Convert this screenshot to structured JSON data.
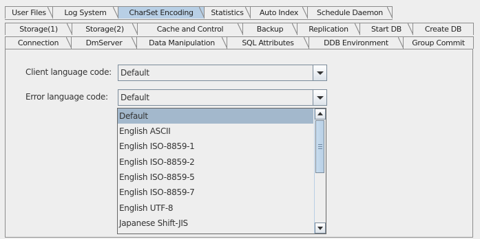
{
  "tabs": {
    "row1": [
      "User Files",
      "Log System",
      "CharSet Encoding",
      "Statistics",
      "Auto Index",
      "Schedule Daemon"
    ],
    "row2": [
      "Storage(1)",
      "Storage(2)",
      "Cache and Control",
      "Backup",
      "Replication",
      "Start DB",
      "Create DB"
    ],
    "row3": [
      "Connection",
      "DmServer",
      "Data Manipulation",
      "SQL Attributes",
      "DDB Environment",
      "Group Commit"
    ],
    "selected": "CharSet Encoding"
  },
  "form": {
    "client_label": "Client language code:",
    "client_value": "Default",
    "error_label": "Error language code:",
    "error_value": "Default"
  },
  "dropdown": {
    "options": [
      "Default",
      "English ASCII",
      "English ISO-8859-1",
      "English ISO-8859-2",
      "English ISO-8859-5",
      "English ISO-8859-7",
      "English UTF-8",
      "Japanese Shift-JIS"
    ],
    "highlighted": "Default"
  },
  "colors": {
    "selected_tab": "#b8cfe5",
    "list_highlight": "#a3b8cc",
    "background": "#eeeeee"
  }
}
